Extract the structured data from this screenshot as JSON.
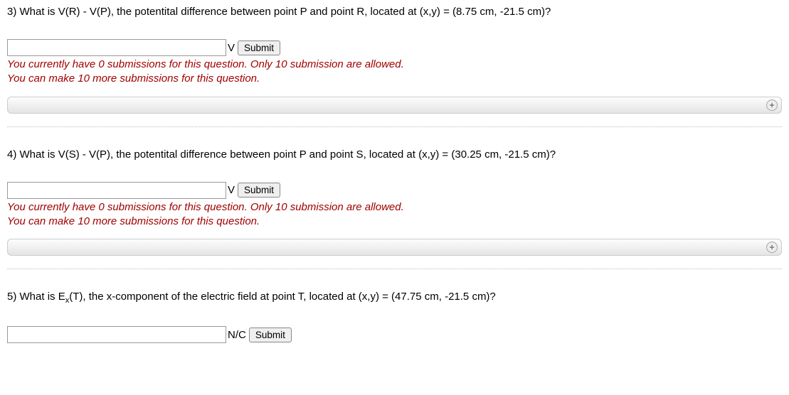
{
  "questions": [
    {
      "number": "3)",
      "text": "What is V(R) - V(P), the potentital difference between point P and point R, located at (x,y) = (8.75 cm, -21.5 cm)?",
      "unit": "V",
      "submit": "Submit",
      "sub_line1": "You currently have 0 submissions for this question. Only 10 submission are allowed.",
      "sub_line2": "You can make 10 more submissions for this question.",
      "has_expand": true
    },
    {
      "number": "4)",
      "text": "What is V(S) - V(P), the potentital difference between point P and point S, located at (x,y) = (30.25 cm, -21.5 cm)?",
      "unit": "V",
      "submit": "Submit",
      "sub_line1": "You currently have 0 submissions for this question. Only 10 submission are allowed.",
      "sub_line2": "You can make 10 more submissions for this question.",
      "has_expand": true
    },
    {
      "number": "5)",
      "text_prefix": "What is E",
      "text_sub": "x",
      "text_suffix": "(T), the x-component of the electric field at point T, located at (x,y) = (47.75 cm, -21.5 cm)?",
      "unit": "N/C",
      "submit": "Submit",
      "has_expand": false
    }
  ]
}
